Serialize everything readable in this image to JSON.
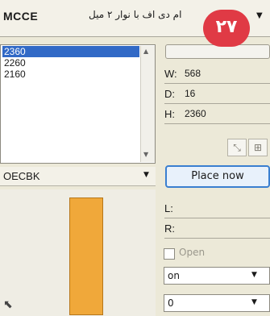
{
  "header": {
    "code": "MCCE",
    "name": "ام دی اف با نوار ۲ میل",
    "badge": "۲۷",
    "dropdown_icon": "triangle-down"
  },
  "list": {
    "items": [
      "2360",
      "2260",
      "2160"
    ],
    "selected_index": 0
  },
  "fields": {
    "w_label": "W:",
    "w_value": "568",
    "d_label": "D:",
    "d_value": "16",
    "h_label": "H:",
    "h_value": "2360",
    "l_label": "L:",
    "r_label": "R:"
  },
  "material_combo": {
    "value": "OECBK"
  },
  "place_button": "Place now",
  "open_checkbox": {
    "label": "Open",
    "checked": false
  },
  "select_one": {
    "value": "on"
  },
  "select_two": {
    "value": "0"
  },
  "colors": {
    "accent": "#3a7fd0",
    "selection": "#3169c6",
    "badge": "#e03a45",
    "panel": "#f0a83a"
  }
}
